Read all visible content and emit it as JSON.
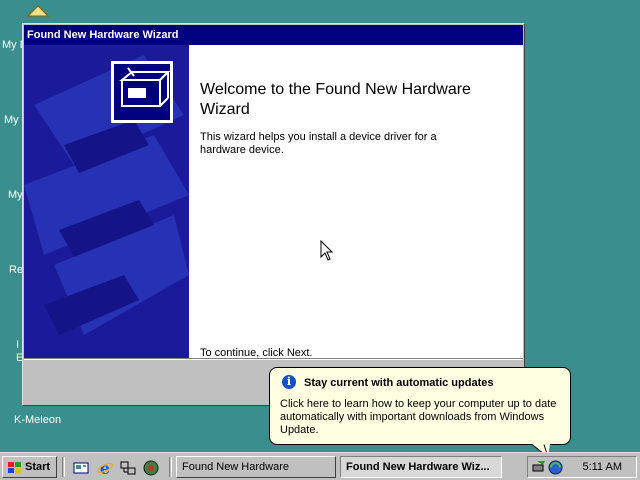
{
  "desktop": {
    "icons": [
      {
        "label": "My D"
      },
      {
        "label": "My"
      },
      {
        "label": "My"
      },
      {
        "label": "Re"
      },
      {
        "label": "I"
      },
      {
        "label": "E"
      },
      {
        "label": "K-Meleon"
      }
    ]
  },
  "wizard": {
    "window_title": "Found New Hardware Wizard",
    "heading": "Welcome to the Found New Hardware Wizard",
    "description": "This wizard helps you install a device driver for a hardware device.",
    "continue_text": "To continue, click Next."
  },
  "balloon": {
    "title": "Stay current with automatic updates",
    "text": "Click here to learn how to keep your computer up to date automatically with important downloads from Windows Update.",
    "icon": "info-icon"
  },
  "taskbar": {
    "start_label": "Start",
    "quick_launch": [
      "show-desktop-icon",
      "internet-explorer-icon",
      "network-icon",
      "k-meleon-icon"
    ],
    "tasks": [
      {
        "label": "Found New Hardware",
        "active": false
      },
      {
        "label": "Found New Hardware Wiz...",
        "active": true
      }
    ],
    "tray_icons": [
      "safely-remove-hardware-icon",
      "windows-update-icon"
    ],
    "clock": "5:11 AM"
  },
  "colors": {
    "desktop": "#3a8e8e",
    "titlebar": "#000080",
    "wizard_side": "#1a1a9a",
    "balloon": "#ffffe1"
  }
}
